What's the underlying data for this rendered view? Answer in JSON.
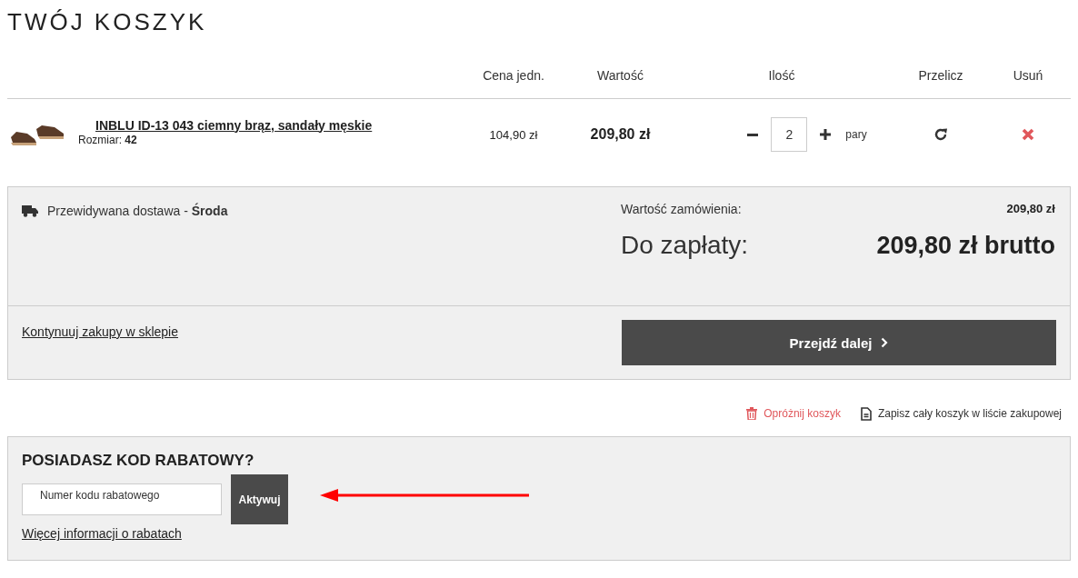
{
  "title": "TWÓJ KOSZYK",
  "table": {
    "columns": [
      "Cena jedn.",
      "Wartość",
      "Ilość",
      "Przelicz",
      "Usuń"
    ],
    "rows": [
      {
        "name": "INBLU ID-13 043 ciemny brąz, sandały męskie",
        "size_label": "Rozmiar:",
        "size": "42",
        "unit_price": "104,90 zł",
        "total": "209,80 zł",
        "quantity": "2",
        "unit": "pary"
      }
    ]
  },
  "summary": {
    "delivery": "Przewidywana dostawa - **Środa**",
    "order_value_label": "Wartość zamówienia:",
    "order_value": "209,80 zł",
    "pay_label": "Do zapłaty:",
    "pay_value": "209,80 zł brutto",
    "continue_link": "Kontynuuj zakupy w sklepie",
    "proceed_button": "Przejdź dalej"
  },
  "actions": [
    {
      "kind": "empty",
      "label": "Opróżnij koszyk"
    },
    {
      "kind": "save",
      "label": "Zapisz cały koszyk w liście zakupowej"
    }
  ],
  "coupon": {
    "title": "POSIADASZ KOD RABATOWY?",
    "placeholder": "Numer kodu rabatowego",
    "button": "Aktywuj",
    "link": "Więcej informacji o rabatach"
  }
}
